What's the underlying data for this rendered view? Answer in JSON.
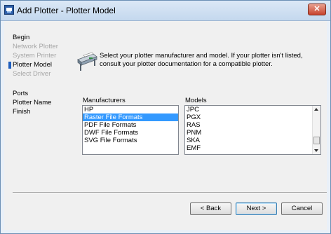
{
  "window": {
    "title": "Add Plotter - Plotter Model",
    "close_label": "✕"
  },
  "steps": [
    {
      "label": "Begin",
      "state": "done"
    },
    {
      "label": "Network Plotter",
      "state": "disabled"
    },
    {
      "label": "System Printer",
      "state": "disabled"
    },
    {
      "label": "Plotter Model",
      "state": "current"
    },
    {
      "label": "Select Driver",
      "state": "disabled"
    },
    {
      "label": "Ports",
      "state": "pending"
    },
    {
      "label": "Plotter Name",
      "state": "pending"
    },
    {
      "label": "Finish",
      "state": "pending"
    }
  ],
  "main": {
    "icon": "plotter-icon",
    "instructions": "Select your plotter manufacturer and model. If your plotter isn't listed, consult your plotter documentation for a compatible plotter.",
    "manufacturers_label": "Manufacturers",
    "models_label": "Models",
    "manufacturers": [
      "HP",
      "Raster File Formats",
      "PDF File Formats",
      "DWF File Formats",
      "SVG File Formats"
    ],
    "manufacturers_selected": "Raster File Formats",
    "models": [
      "JPC",
      "PGX",
      "RAS",
      "PNM",
      "SKA",
      "EMF"
    ]
  },
  "buttons": {
    "back": "< Back",
    "next": "Next >",
    "cancel": "Cancel"
  },
  "colors": {
    "selection": "#3399ff",
    "title_bar": "#c4d8ee",
    "dialog_bg": "#f0f0f0"
  }
}
